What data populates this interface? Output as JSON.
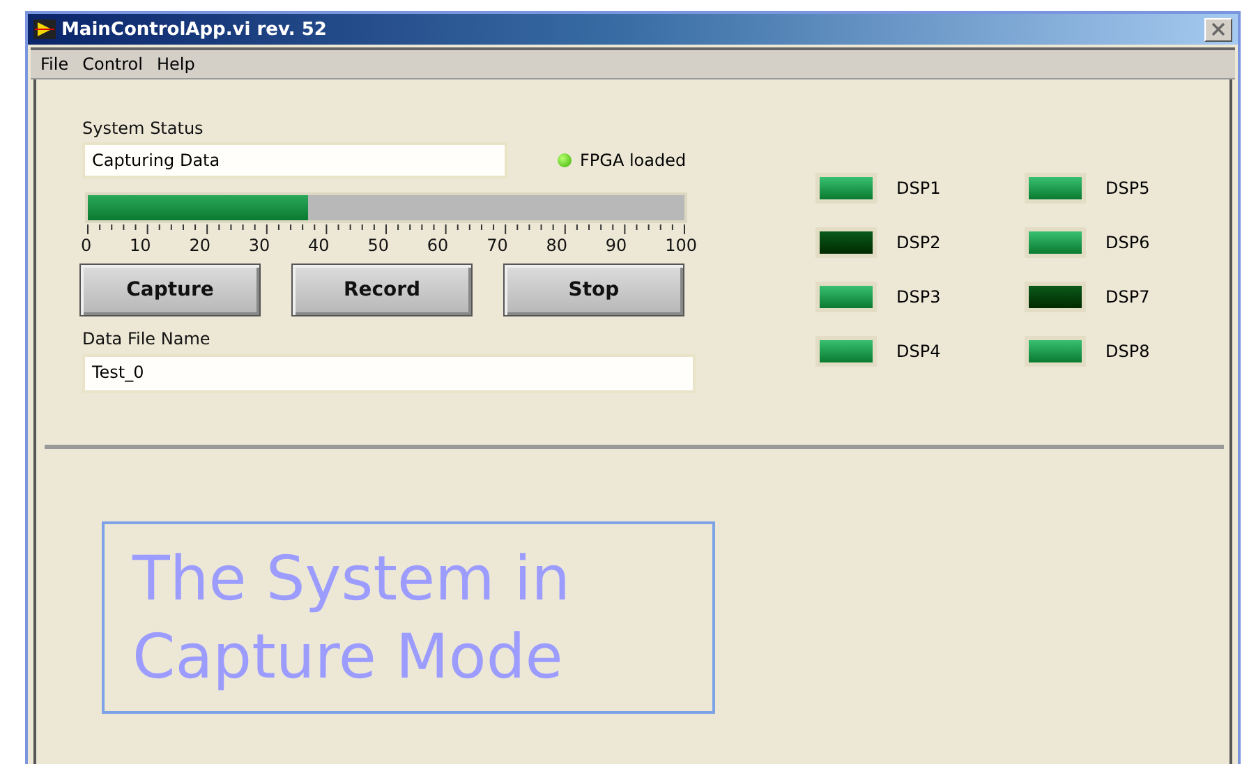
{
  "window": {
    "title": "MainControlApp.vi rev. 52"
  },
  "menu": [
    "File",
    "Control",
    "Help"
  ],
  "system_status": {
    "label": "System Status",
    "value": "Capturing Data"
  },
  "fpga": {
    "label": "FPGA loaded",
    "on": true
  },
  "progress": {
    "level": 0.37,
    "scale": [
      "0",
      "10",
      "20",
      "30",
      "40",
      "50",
      "60",
      "70",
      "80",
      "90",
      "100"
    ]
  },
  "buttons": [
    "Capture",
    "Record",
    "Stop"
  ],
  "data_file": {
    "label": "Data File Name",
    "value": "Test_0"
  },
  "dsps": [
    {
      "label": "DSP1",
      "on": true
    },
    {
      "label": "DSP2",
      "on": false
    },
    {
      "label": "DSP3",
      "on": true
    },
    {
      "label": "DSP4",
      "on": true
    },
    {
      "label": "DSP5",
      "on": true
    },
    {
      "label": "DSP6",
      "on": true
    },
    {
      "label": "DSP7",
      "on": false
    },
    {
      "label": "DSP8",
      "on": true
    }
  ],
  "caption": {
    "lines": [
      "The System in",
      "Capture Mode"
    ]
  }
}
